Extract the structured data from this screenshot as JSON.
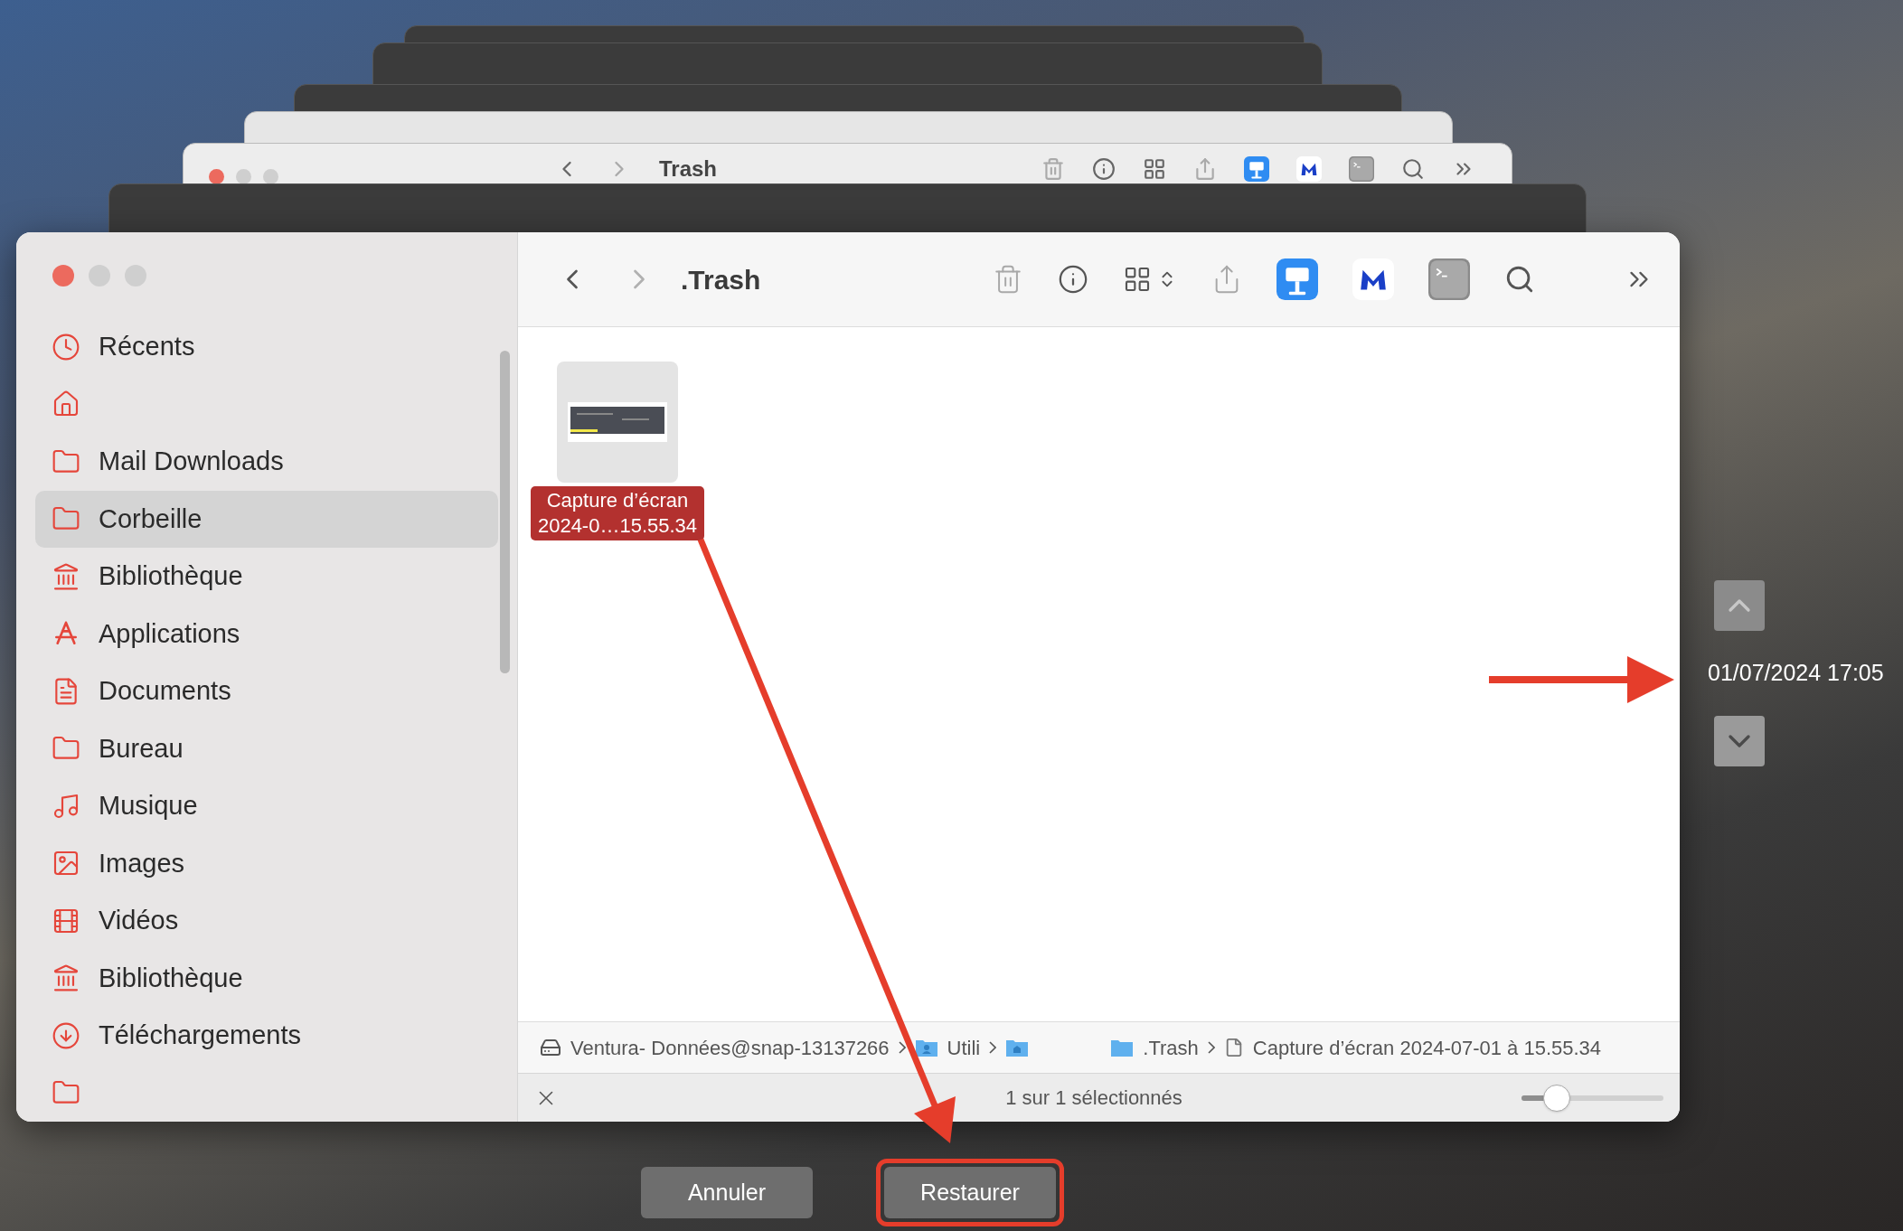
{
  "back_windows": [
    {
      "kind": "dark"
    },
    {
      "kind": "dark"
    },
    {
      "kind": "dark"
    },
    {
      "kind": "strip"
    },
    {
      "kind": "light",
      "title": "Trash"
    },
    {
      "kind": "dark"
    }
  ],
  "window": {
    "title": ".Trash"
  },
  "sidebar": {
    "items": [
      {
        "kind": "clock",
        "label": "Récents",
        "selected": false
      },
      {
        "kind": "home",
        "selected": false
      },
      {
        "kind": "folder",
        "label": "Mail Downloads",
        "selected": false
      },
      {
        "kind": "folder",
        "label": "Corbeille",
        "selected": true
      },
      {
        "kind": "library",
        "label": "Bibliothèque",
        "selected": false
      },
      {
        "kind": "apps",
        "label": "Applications",
        "selected": false
      },
      {
        "kind": "document",
        "label": "Documents",
        "selected": false
      },
      {
        "kind": "folder",
        "label": "Bureau",
        "selected": false
      },
      {
        "kind": "music",
        "label": "Musique",
        "selected": false
      },
      {
        "kind": "image",
        "label": "Images",
        "selected": false
      },
      {
        "kind": "film",
        "label": "Vidéos",
        "selected": false
      },
      {
        "kind": "library",
        "label": "Bibliothèque",
        "selected": false
      },
      {
        "kind": "download",
        "label": "Téléchargements",
        "selected": false
      },
      {
        "kind": "folder",
        "selected": false
      }
    ]
  },
  "files": [
    {
      "name_lines": [
        "Capture d’écran",
        "2024-0…15.55.34"
      ],
      "selected": true
    }
  ],
  "path_bar": [
    {
      "kind": "disk",
      "label": "Ventura- Données@snap-13137266"
    },
    {
      "kind": "user-folder",
      "label": "Utili"
    },
    {
      "kind": "home-folder"
    },
    {
      "kind": "folder",
      "label": ".Trash"
    },
    {
      "kind": "file",
      "label": "Capture d’écran 2024-07-01 à 15.55.34"
    }
  ],
  "status_bar": {
    "text": "1 sur 1 sélectionnés",
    "zoom": {
      "level": 0.25
    }
  },
  "timeline": {
    "date": "01/07/2024 17:05"
  },
  "buttons": [
    {
      "label": "Annuler",
      "highlighted": false
    },
    {
      "label": "Restaurer",
      "highlighted": true
    }
  ]
}
